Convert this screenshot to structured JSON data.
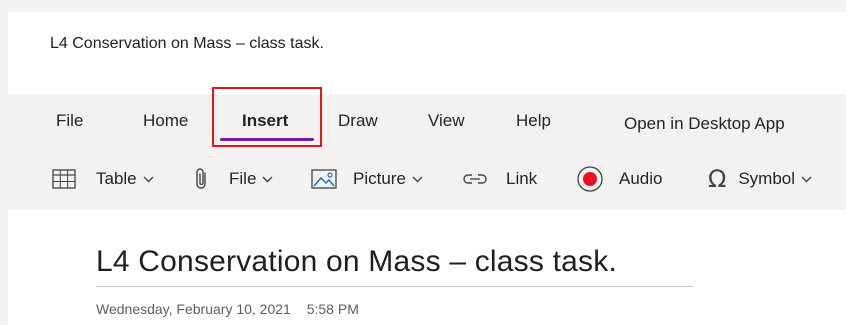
{
  "document": {
    "title": "L4 Conservation on Mass – class task."
  },
  "ribbon": {
    "tabs": [
      {
        "label": "File"
      },
      {
        "label": "Home"
      },
      {
        "label": "Insert",
        "selected": true
      },
      {
        "label": "Draw"
      },
      {
        "label": "View"
      },
      {
        "label": "Help"
      }
    ],
    "open_desktop_label": "Open in Desktop App",
    "accent_color": "#7719aa",
    "highlight_box_color": "#e8141b"
  },
  "toolbar": {
    "table_label": "Table",
    "table_icon": "table-icon",
    "file_label": "File",
    "file_icon": "paperclip-icon",
    "picture_label": "Picture",
    "picture_icon": "picture-icon",
    "link_label": "Link",
    "link_icon": "link-icon",
    "audio_label": "Audio",
    "audio_icon": "record-icon",
    "audio_color": "#e81123",
    "symbol_label": "Symbol",
    "symbol_icon": "omega-icon"
  },
  "page": {
    "title": "L4 Conservation on Mass – class task.",
    "date": "Wednesday, February 10, 2021",
    "time": "5:58 PM"
  }
}
